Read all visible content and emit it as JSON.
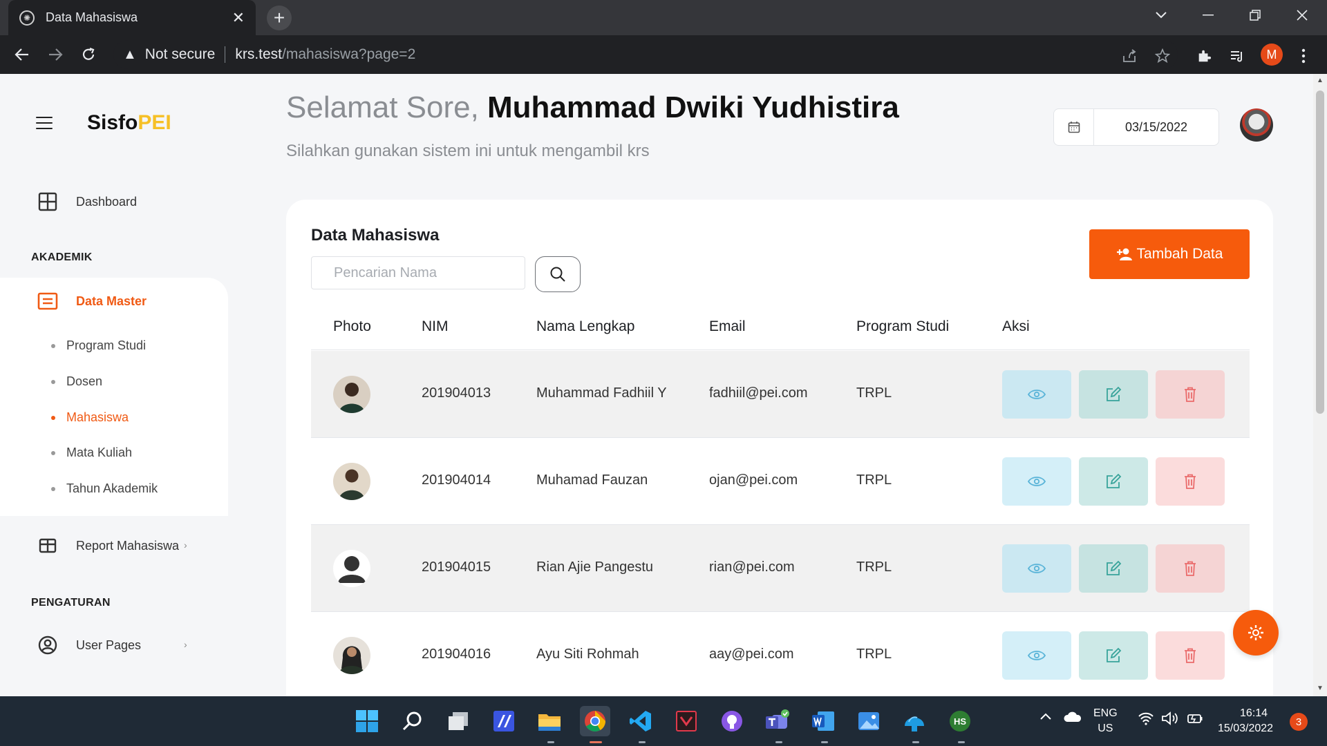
{
  "browser": {
    "tab_title": "Data Mahasiswa",
    "close_glyph": "✕",
    "new_tab_glyph": "+",
    "security_label": "Not secure",
    "url_host": "krs.test",
    "url_path": "/mahasiswa?page=2",
    "profile_initial": "M"
  },
  "sidebar": {
    "brand_main": "Sisfo",
    "brand_highlight": "PEI",
    "dashboard_label": "Dashboard",
    "section_akademik": "AKADEMIK",
    "data_master_label": "Data Master",
    "sub_items": [
      "Program Studi",
      "Dosen",
      "Mahasiswa",
      "Mata Kuliah",
      "Tahun Akademik"
    ],
    "active_sub_item": "Mahasiswa",
    "report_label": "Report Mahasiswa",
    "section_pengaturan": "PENGATURAN",
    "user_pages_label": "User Pages",
    "chevron_glyph": "›"
  },
  "header": {
    "greeting": "Selamat Sore, ",
    "user_name": "Muhammad Dwiki Yudhistira",
    "subtitle": "Silahkan gunakan sistem ini untuk mengambil krs",
    "date_value": "03/15/2022"
  },
  "card": {
    "title": "Data Mahasiswa",
    "search_placeholder": "Pencarian Nama",
    "add_button_label": "Tambah Data",
    "columns": [
      "Photo",
      "NIM",
      "Nama Lengkap",
      "Email",
      "Program Studi",
      "Aksi"
    ],
    "rows": [
      {
        "nim": "201904013",
        "nama": "Muhammad Fadhiil Y",
        "email": "fadhiil@pei.com",
        "prodi": "TRPL"
      },
      {
        "nim": "201904014",
        "nama": "Muhamad Fauzan",
        "email": "ojan@pei.com",
        "prodi": "TRPL"
      },
      {
        "nim": "201904015",
        "nama": "Rian Ajie Pangestu",
        "email": "rian@pei.com",
        "prodi": "TRPL"
      },
      {
        "nim": "201904016",
        "nama": "Ayu Siti Rohmah",
        "email": "aay@pei.com",
        "prodi": "TRPL"
      }
    ]
  },
  "taskbar": {
    "apps": [
      "start",
      "search",
      "task-view",
      "app-blue",
      "file-explorer",
      "chrome",
      "vscode",
      "app-red",
      "github",
      "teams",
      "word",
      "photos",
      "hat-app",
      "hs-app"
    ],
    "hs_label": "HS",
    "lang_top": "ENG",
    "lang_bottom": "US",
    "time": "16:14",
    "date": "15/03/2022",
    "notification_count": "3"
  },
  "colors": {
    "accent": "#f65b0c",
    "brand_highlight": "#f6c026",
    "view_btn": "#d4eff8",
    "edit_btn": "#cde9e7",
    "delete_btn": "#fbdcdc"
  }
}
